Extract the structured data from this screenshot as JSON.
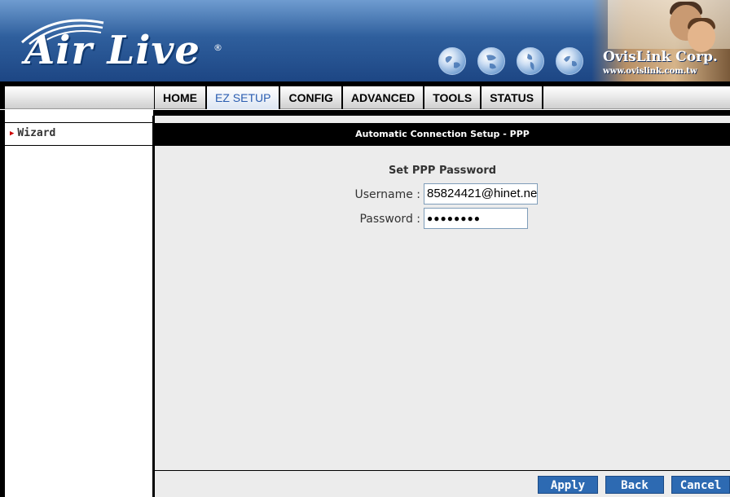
{
  "brand": {
    "logo_text": "Air Live",
    "logo_mark": "®",
    "company_name": "OvisLink Corp.",
    "company_url": "www.ovislink.com.tw"
  },
  "nav": {
    "tabs": [
      {
        "label": "HOME",
        "active": false
      },
      {
        "label": "EZ SETUP",
        "active": true
      },
      {
        "label": "CONFIG",
        "active": false
      },
      {
        "label": "ADVANCED",
        "active": false
      },
      {
        "label": "TOOLS",
        "active": false
      },
      {
        "label": "STATUS",
        "active": false
      }
    ]
  },
  "sidebar": {
    "items": [
      {
        "label": "Wizard",
        "icon": "red-triangle-arrow-icon"
      }
    ]
  },
  "main": {
    "header": "Automatic Connection Setup - PPP",
    "form_title": "Set PPP Password",
    "username_label": "Username :",
    "username_value": "85824421@hinet.ne",
    "password_label": "Password :",
    "password_value": "●●●●●●●●"
  },
  "buttons": {
    "apply": "Apply",
    "back": "Back",
    "cancel": "Cancel"
  },
  "colors": {
    "accent_button": "#2d6ab2",
    "active_tab_text": "#2a5db0",
    "panel_bg": "#ececec",
    "header_bg": "#000000",
    "sidebar_arrow": "#cc0000"
  }
}
